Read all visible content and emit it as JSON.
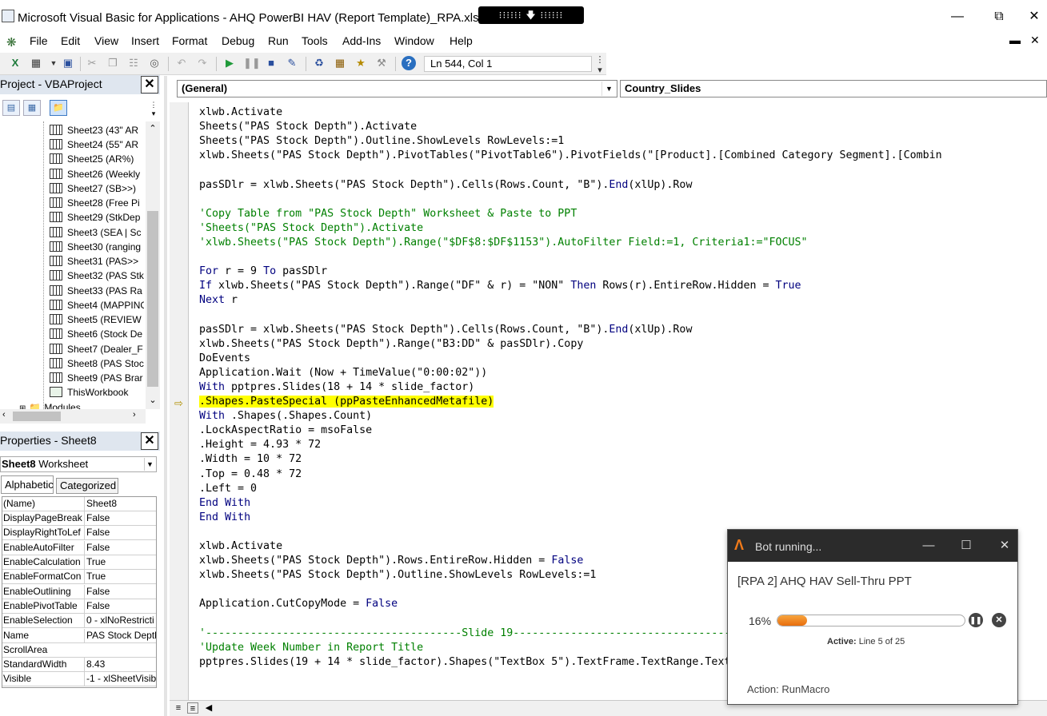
{
  "window": {
    "title": "Microsoft Visual Basic for Applications - AHQ PowerBI HAV (Report Template)_RPA.xlsb [break] -",
    "title_tail": "])",
    "overlay_text": "⁝⁝⁝⁝⁝⁝ 🡇 ⁝⁝⁝⁝⁝⁝"
  },
  "menu": {
    "items": [
      "File",
      "Edit",
      "View",
      "Insert",
      "Format",
      "Debug",
      "Run",
      "Tools",
      "Add-Ins",
      "Window",
      "Help"
    ]
  },
  "toolbar": {
    "position": "Ln 544, Col 1"
  },
  "project": {
    "title": "Project - VBAProject",
    "items": [
      "Sheet23 (43\" AR",
      "Sheet24 (55\" AR",
      "Sheet25 (AR%)",
      "Sheet26 (Weekly",
      "Sheet27 (SB>>)",
      "Sheet28 (Free Pi",
      "Sheet29 (StkDep",
      "Sheet3 (SEA | Sc",
      "Sheet30 (ranging",
      "Sheet31 (PAS>>",
      "Sheet32 (PAS Stk",
      "Sheet33 (PAS Ra",
      "Sheet4 (MAPPING",
      "Sheet5 (REVIEW",
      "Sheet6 (Stock De",
      "Sheet7 (Dealer_F",
      "Sheet8 (PAS Stoc",
      "Sheet9 (PAS Brar",
      "ThisWorkbook",
      "Modules"
    ]
  },
  "properties": {
    "title": "Properties - Sheet8",
    "object_name": "Sheet8",
    "object_type": "Worksheet",
    "tabs": [
      "Alphabetic",
      "Categorized"
    ],
    "rows": [
      {
        "name": "(Name)",
        "value": "Sheet8"
      },
      {
        "name": "DisplayPageBreak",
        "value": "False"
      },
      {
        "name": "DisplayRightToLef",
        "value": "False"
      },
      {
        "name": "EnableAutoFilter",
        "value": "False"
      },
      {
        "name": "EnableCalculation",
        "value": "True"
      },
      {
        "name": "EnableFormatCon",
        "value": "True"
      },
      {
        "name": "EnableOutlining",
        "value": "False"
      },
      {
        "name": "EnablePivotTable",
        "value": "False"
      },
      {
        "name": "EnableSelection",
        "value": "0 - xlNoRestricti"
      },
      {
        "name": "Name",
        "value": "PAS Stock Depth"
      },
      {
        "name": "ScrollArea",
        "value": ""
      },
      {
        "name": "StandardWidth",
        "value": "8.43"
      },
      {
        "name": "Visible",
        "value": "-1 - xlSheetVisib"
      }
    ]
  },
  "code": {
    "object_combo": "(General)",
    "procedure_combo": "Country_Slides",
    "lines": [
      "xlwb.Activate",
      "Sheets(\"PAS Stock Depth\").Activate",
      "Sheets(\"PAS Stock Depth\").Outline.ShowLevels RowLevels:=1",
      "xlwb.Sheets(\"PAS Stock Depth\").PivotTables(\"PivotTable6\").PivotFields(\"[Product].[Combined Category Segment].[Combin",
      "",
      "pasSDlr = xlwb.Sheets(\"PAS Stock Depth\").Cells(Rows.Count, \"B\").End(xlUp).Row",
      "",
      "'Copy Table from \"PAS Stock Depth\" Worksheet & Paste to PPT",
      "'Sheets(\"PAS Stock Depth\").Activate",
      "'xlwb.Sheets(\"PAS Stock Depth\").Range(\"$DF$8:$DF$1153\").AutoFilter Field:=1, Criteria1:=\"FOCUS\"",
      "",
      "For r = 9 To pasSDlr",
      "If xlwb.Sheets(\"PAS Stock Depth\").Range(\"DF\" & r) = \"NON\" Then Rows(r).EntireRow.Hidden = True",
      "Next r",
      "",
      "pasSDlr = xlwb.Sheets(\"PAS Stock Depth\").Cells(Rows.Count, \"B\").End(xlUp).Row",
      "xlwb.Sheets(\"PAS Stock Depth\").Range(\"B3:DD\" & pasSDlr).Copy",
      "DoEvents",
      "Application.Wait (Now + TimeValue(\"0:00:02\"))",
      "With pptpres.Slides(18 + 14 * slide_factor)",
      ".Shapes.PasteSpecial (ppPasteEnhancedMetafile)",
      "With .Shapes(.Shapes.Count)",
      ".LockAspectRatio = msoFalse",
      ".Height = 4.93 * 72",
      ".Width = 10 * 72",
      ".Top = 0.48 * 72",
      ".Left = 0",
      "End With",
      "End With",
      "",
      "xlwb.Activate",
      "xlwb.Sheets(\"PAS Stock Depth\").Rows.EntireRow.Hidden = False",
      "xlwb.Sheets(\"PAS Stock Depth\").Outline.ShowLevels RowLevels:=1",
      "",
      "Application.CutCopyMode = False",
      "",
      "'----------------------------------------Slide 19------------------------------------------",
      "'Update Week Number in Report Title",
      "pptpres.Slides(19 + 14 * slide_factor).Shapes(\"TextBox 5\").TextFrame.TextRange.Text"
    ]
  },
  "bot": {
    "title": "Bot running...",
    "task": "[RPA 2] AHQ HAV Sell-Thru PPT",
    "percent_label": "16%",
    "progress": 0.16,
    "active_label": "Active:",
    "active_value": "Line 5 of 25",
    "action": "Action: RunMacro"
  }
}
